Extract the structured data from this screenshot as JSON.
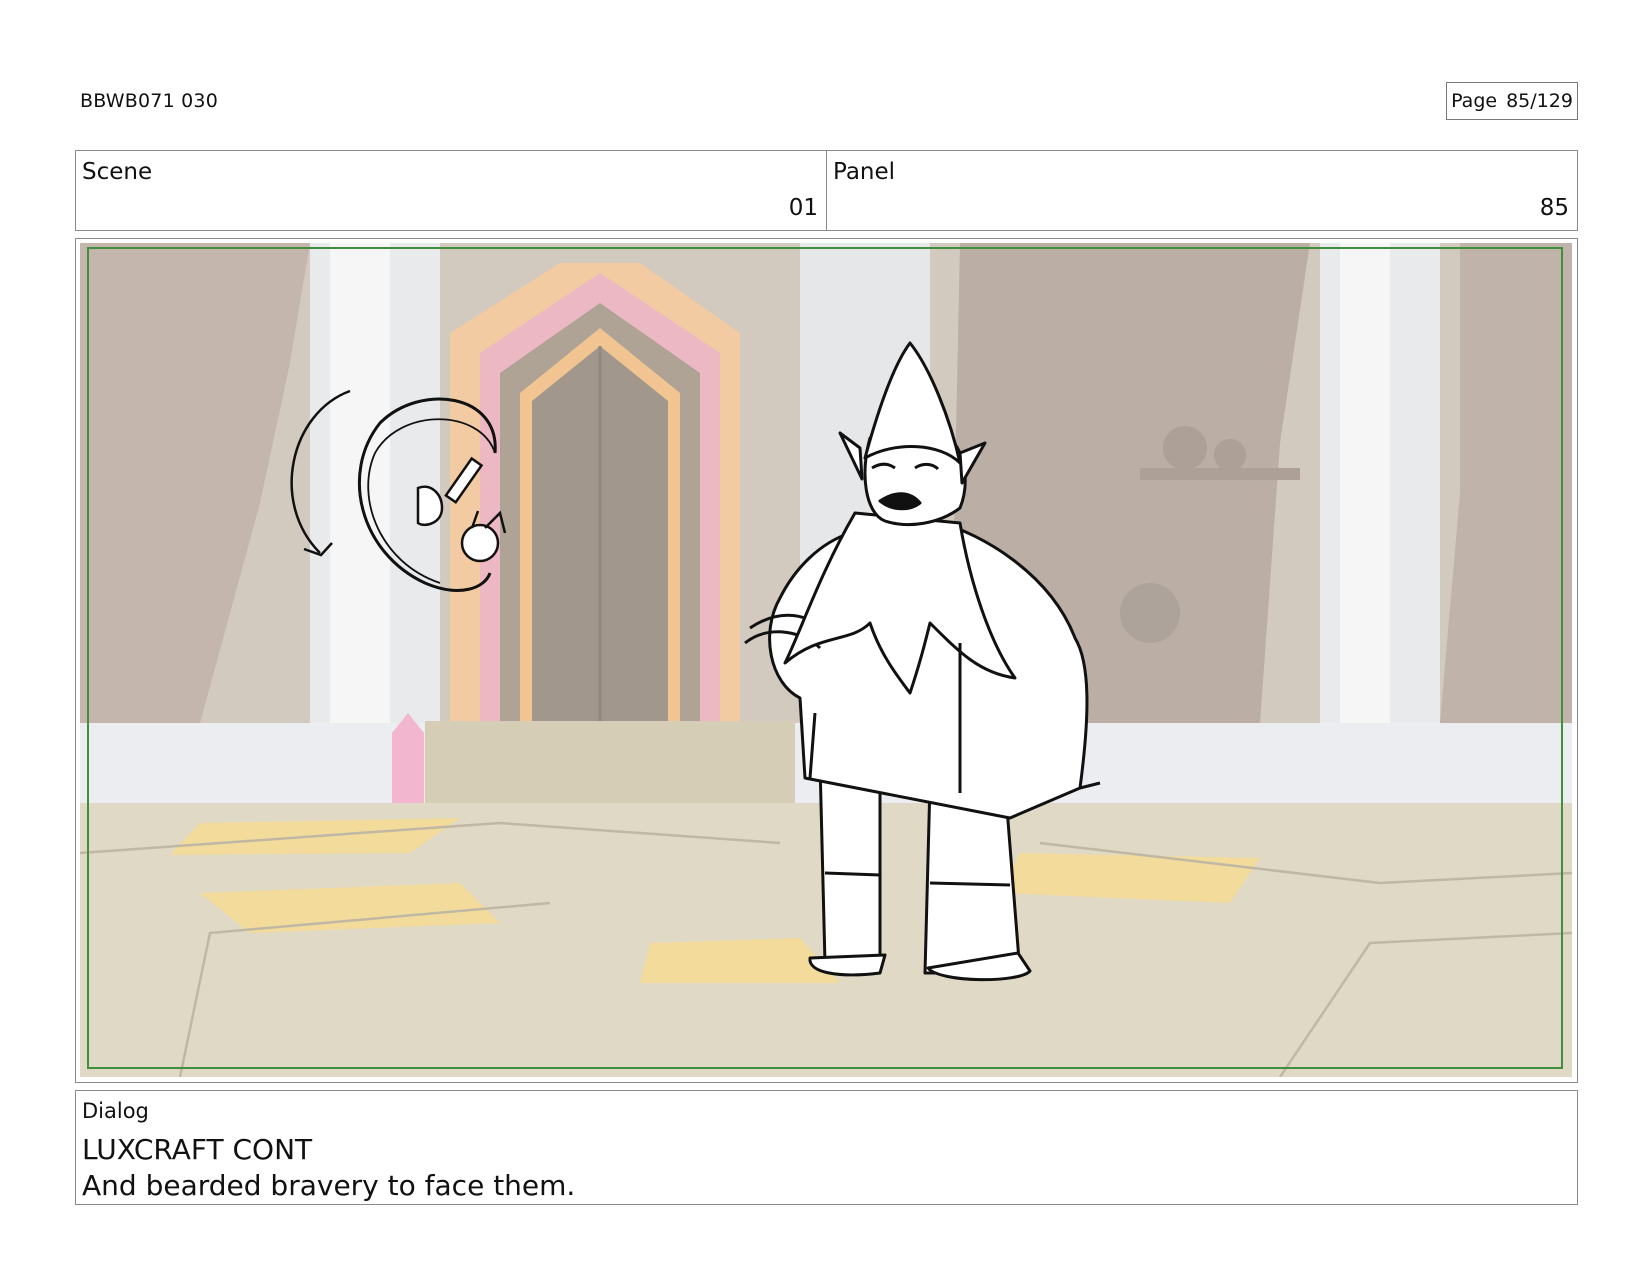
{
  "document": {
    "id": "BBWB071 030",
    "page_label": "Page",
    "page_number": "85/129"
  },
  "header": {
    "scene_label": "Scene",
    "scene_value": "01",
    "panel_label": "Panel",
    "panel_value": "85"
  },
  "dialog": {
    "label": "Dialog",
    "character": "LUXCRAFT CONT",
    "line": "And bearded bravery to face them."
  },
  "colors": {
    "frame_border": "#3f8f3f",
    "wall": "#bfb2a5",
    "floor": "#d9d1b9",
    "door": "#8d8174",
    "door_pink": "#e8a9b6",
    "door_orange": "#efc08e",
    "crystal": "#f0a6c4",
    "floor_highlight": "#f2d57c"
  }
}
